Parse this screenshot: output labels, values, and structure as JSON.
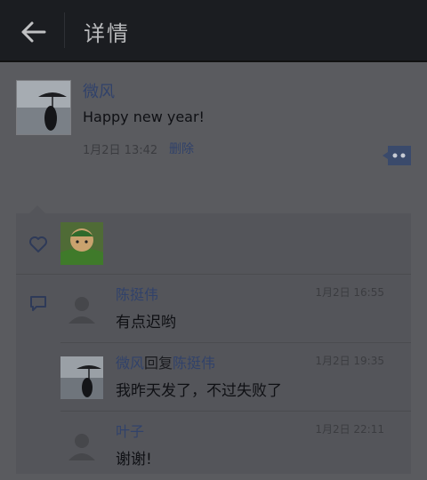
{
  "header": {
    "title": "详情"
  },
  "post": {
    "author": "微风",
    "text": "Happy new year!",
    "time": "1月2日 13:42",
    "delete_label": "删除"
  },
  "comments": [
    {
      "author": "陈挺伟",
      "time": "1月2日 16:55",
      "text": "有点迟哟",
      "avatar": "default"
    },
    {
      "author": "微风",
      "reply_word": "回复",
      "reply_to": "陈挺伟",
      "time": "1月2日 19:35",
      "text": "我昨天发了，不过失败了",
      "avatar": "photo"
    },
    {
      "author": "叶子",
      "time": "1月2日 22:11",
      "text": "谢谢!",
      "avatar": "default"
    }
  ],
  "icons": {
    "back": "back-arrow-icon",
    "more": "comment-more-icon",
    "like": "heart-icon",
    "comment": "comment-bubble-icon"
  },
  "colors": {
    "link_name": "#31426a",
    "titlebar": "#1b1d21",
    "background": "#5a5b5f"
  }
}
